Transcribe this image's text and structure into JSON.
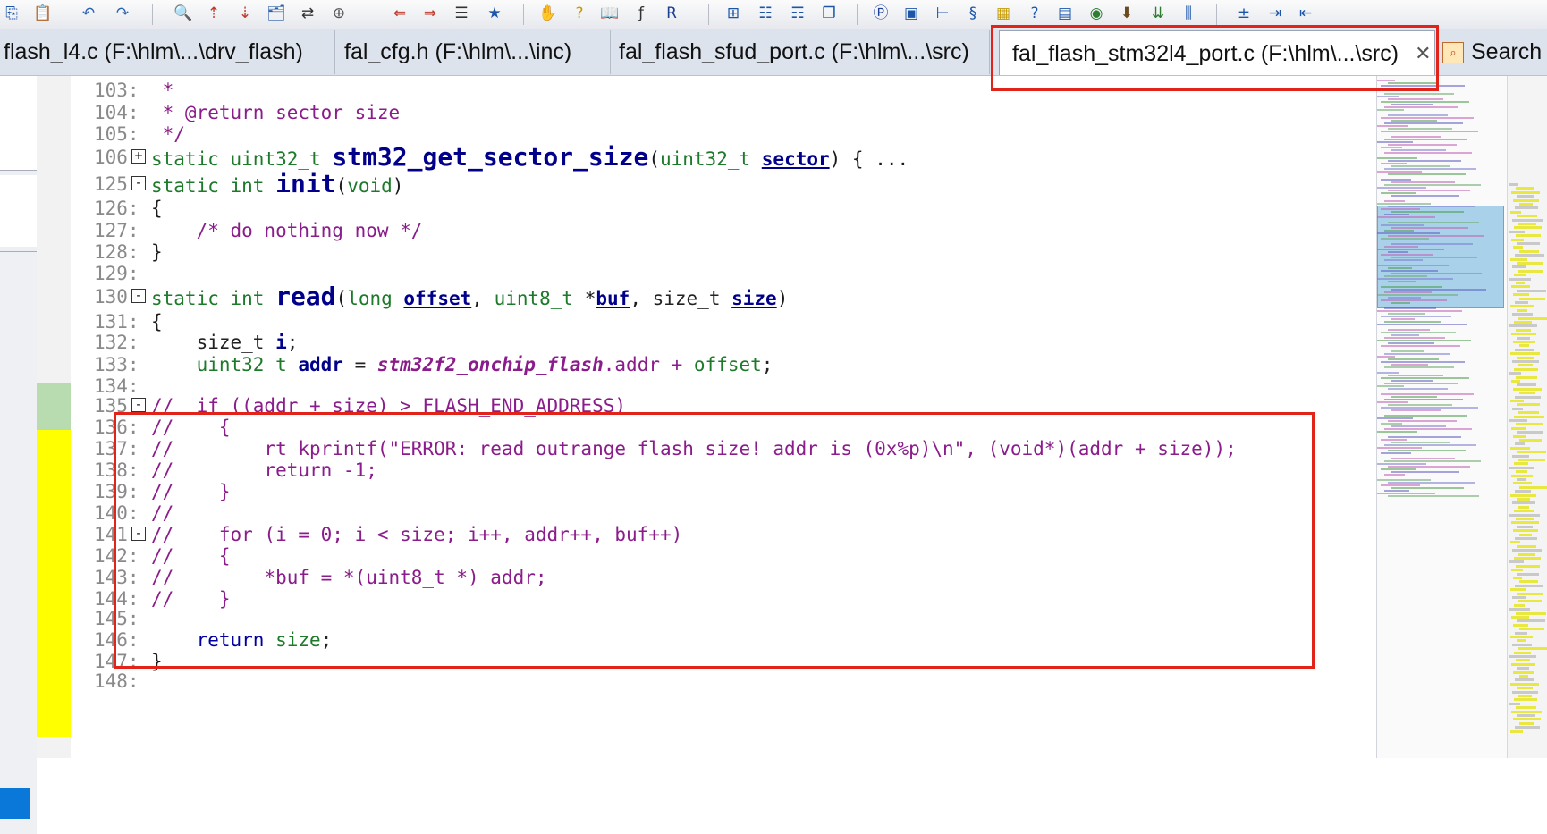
{
  "toolbar": {
    "icons": [
      "copy-icon",
      "paste-icon",
      "undo-icon",
      "redo-icon",
      "find-icon",
      "find-prev-icon",
      "find-next-icon",
      "find-files-icon",
      "replace-icon",
      "web-icon",
      "bookmark-prev-icon",
      "bookmark-next-icon",
      "bookmark-list-icon",
      "bookmark-star-icon",
      "hand-icon",
      "help-icon",
      "book-icon",
      "function-icon",
      "regex-icon",
      "layout-grid-icon",
      "layout-list-icon",
      "layout-detail-icon",
      "window-icon",
      "p-circle-icon",
      "image-icon",
      "tree-icon",
      "script-icon",
      "blocks-icon",
      "help-box-icon",
      "clipboard-icon",
      "globe-icon",
      "arrow-down-icon",
      "merge-icon",
      "columns-icon",
      "plus-minus-icon",
      "indent-icon",
      "outdent-icon"
    ]
  },
  "tabs": [
    {
      "label": "flash_l4.c (F:\\hlm\\...\\drv_flash)",
      "active": false
    },
    {
      "label": "fal_cfg.h (F:\\hlm\\...\\inc)",
      "active": false
    },
    {
      "label": "fal_flash_sfud_port.c (F:\\hlm\\...\\src)",
      "active": false
    },
    {
      "label": "fal_flash_stm32l4_port.c (F:\\hlm\\...\\src)",
      "active": true
    }
  ],
  "close_glyph": "✕",
  "search_tab": {
    "label": "Search"
  },
  "colors": {
    "highlight_box": "#e2231a",
    "changed_green": "#b8dcb0",
    "changed_yellow": "#ffff00",
    "comment": "#8b1c8b",
    "keyword": "#1d7a2a"
  },
  "code": {
    "lines": [
      {
        "n": "103:",
        "fold": "",
        "tokens": [
          {
            "t": " *",
            "c": "c-com"
          }
        ]
      },
      {
        "n": "104:",
        "fold": "",
        "tokens": [
          {
            "t": " * @return sector size",
            "c": "c-com"
          }
        ]
      },
      {
        "n": "105:",
        "fold": "",
        "tokens": [
          {
            "t": " */",
            "c": "c-com"
          }
        ]
      },
      {
        "n": "106",
        "fold": "+",
        "tokens": [
          {
            "t": "static ",
            "c": "c-kw"
          },
          {
            "t": "uint32_t ",
            "c": "c-type"
          },
          {
            "t": "stm32_get_sector_size",
            "c": "c-fn"
          },
          {
            "t": "(",
            "c": "c-par"
          },
          {
            "t": "uint32_t ",
            "c": "c-type"
          },
          {
            "t": "sector",
            "c": "c-param"
          },
          {
            "t": ") { ...",
            "c": "c-par"
          }
        ]
      },
      {
        "n": "125",
        "fold": "-",
        "tokens": [
          {
            "t": "static ",
            "c": "c-kw"
          },
          {
            "t": "int ",
            "c": "c-type"
          },
          {
            "t": "init",
            "c": "c-fn"
          },
          {
            "t": "(",
            "c": "c-par"
          },
          {
            "t": "void",
            "c": "c-type"
          },
          {
            "t": ")",
            "c": "c-par"
          }
        ]
      },
      {
        "n": "126:",
        "fold": "",
        "tokens": [
          {
            "t": "{",
            "c": "c-par"
          }
        ]
      },
      {
        "n": "127:",
        "fold": "",
        "tokens": [
          {
            "t": "    /* do nothing now */",
            "c": "c-com"
          }
        ]
      },
      {
        "n": "128:",
        "fold": "",
        "tokens": [
          {
            "t": "}",
            "c": "c-par"
          }
        ]
      },
      {
        "n": "129:",
        "fold": "",
        "tokens": []
      },
      {
        "n": "130",
        "fold": "-",
        "tokens": [
          {
            "t": "static ",
            "c": "c-kw"
          },
          {
            "t": "int ",
            "c": "c-type"
          },
          {
            "t": "read",
            "c": "c-fn"
          },
          {
            "t": "(",
            "c": "c-par"
          },
          {
            "t": "long ",
            "c": "c-type"
          },
          {
            "t": "offset",
            "c": "c-param"
          },
          {
            "t": ", ",
            "c": "c-par"
          },
          {
            "t": "uint8_t ",
            "c": "c-type"
          },
          {
            "t": "*",
            "c": "c-par"
          },
          {
            "t": "buf",
            "c": "c-param"
          },
          {
            "t": ", ",
            "c": "c-par"
          },
          {
            "t": "size_t ",
            "c": "c-plain"
          },
          {
            "t": "size",
            "c": "c-param"
          },
          {
            "t": ")",
            "c": "c-par"
          }
        ]
      },
      {
        "n": "131:",
        "fold": "",
        "tokens": [
          {
            "t": "{",
            "c": "c-par"
          }
        ]
      },
      {
        "n": "132:",
        "fold": "",
        "tokens": [
          {
            "t": "    size_t ",
            "c": "c-plain"
          },
          {
            "t": "i",
            "c": "c-var"
          },
          {
            "t": ";",
            "c": "c-plain"
          }
        ]
      },
      {
        "n": "133:",
        "fold": "",
        "tokens": [
          {
            "t": "    uint32_t ",
            "c": "c-type"
          },
          {
            "t": "addr",
            "c": "c-var"
          },
          {
            "t": " = ",
            "c": "c-plain"
          },
          {
            "t": "stm32f2_onchip_flash",
            "c": "c-glob"
          },
          {
            "t": ".addr + ",
            "c": "c-com"
          },
          {
            "t": "offset",
            "c": "c-kw"
          },
          {
            "t": ";",
            "c": "c-plain"
          }
        ]
      },
      {
        "n": "134:",
        "fold": "",
        "tokens": []
      },
      {
        "n": "135",
        "fold": "-",
        "tokens": [
          {
            "t": "//  if ((addr + size) > FLASH_END_ADDRESS)",
            "c": "c-com"
          }
        ]
      },
      {
        "n": "136:",
        "fold": "",
        "tokens": [
          {
            "t": "//    {",
            "c": "c-com"
          }
        ]
      },
      {
        "n": "137:",
        "fold": "",
        "tokens": [
          {
            "t": "//        rt_kprintf(\"ERROR: read outrange flash size! addr is (0x%p)\\n\", (void*)(addr + size));",
            "c": "c-com"
          }
        ]
      },
      {
        "n": "138:",
        "fold": "",
        "tokens": [
          {
            "t": "//        return -1;",
            "c": "c-com"
          }
        ]
      },
      {
        "n": "139:",
        "fold": "",
        "tokens": [
          {
            "t": "//    }",
            "c": "c-com"
          }
        ]
      },
      {
        "n": "140:",
        "fold": "",
        "tokens": [
          {
            "t": "//",
            "c": "c-com"
          }
        ]
      },
      {
        "n": "141",
        "fold": "-",
        "tokens": [
          {
            "t": "//    for (i = 0; i < size; i++, addr++, buf++)",
            "c": "c-com"
          }
        ]
      },
      {
        "n": "142:",
        "fold": "",
        "tokens": [
          {
            "t": "//    {",
            "c": "c-com"
          }
        ]
      },
      {
        "n": "143:",
        "fold": "",
        "tokens": [
          {
            "t": "//        *buf = *(uint8_t *) addr;",
            "c": "c-com"
          }
        ]
      },
      {
        "n": "144:",
        "fold": "",
        "tokens": [
          {
            "t": "//    }",
            "c": "c-com"
          }
        ]
      },
      {
        "n": "145:",
        "fold": "",
        "tokens": []
      },
      {
        "n": "146:",
        "fold": "",
        "tokens": [
          {
            "t": "    ",
            "c": "c-plain"
          },
          {
            "t": "return ",
            "c": "c-blue"
          },
          {
            "t": "size",
            "c": "c-kw"
          },
          {
            "t": ";",
            "c": "c-plain"
          }
        ]
      },
      {
        "n": "147:",
        "fold": "",
        "tokens": [
          {
            "t": "}",
            "c": "c-par"
          }
        ]
      },
      {
        "n": "148:",
        "fold": "",
        "tokens": []
      }
    ]
  }
}
